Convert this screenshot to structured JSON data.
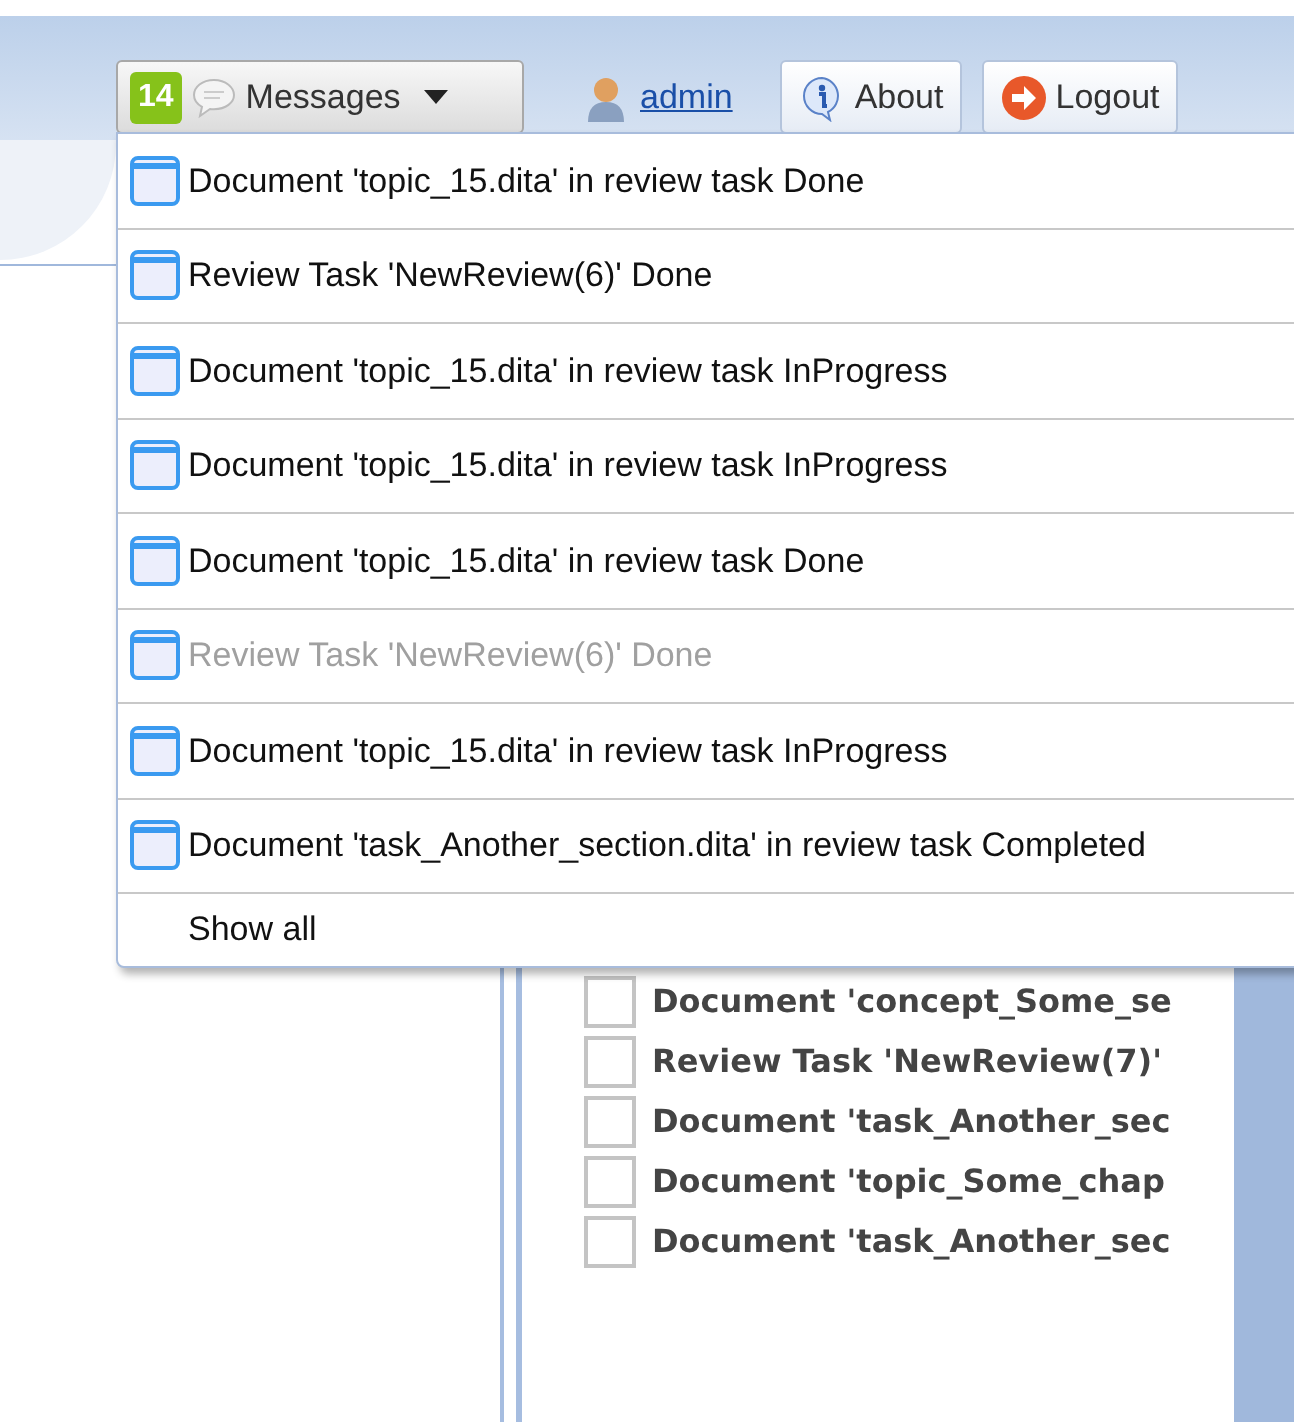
{
  "toolbar": {
    "messages_count": "14",
    "messages_label": "Messages",
    "user": "admin",
    "about": "About",
    "logout": "Logout"
  },
  "messages": [
    {
      "text": "Document 'topic_15.dita' in review task Done",
      "read": false
    },
    {
      "text": "Review Task 'NewReview(6)' Done",
      "read": false
    },
    {
      "text": "Document 'topic_15.dita' in review task InProgress",
      "read": false
    },
    {
      "text": "Document 'topic_15.dita' in review task InProgress",
      "read": false
    },
    {
      "text": "Document 'topic_15.dita' in review task Done",
      "read": false
    },
    {
      "text": "Review Task 'NewReview(6)' Done",
      "read": true
    },
    {
      "text": "Document 'topic_15.dita' in review task InProgress",
      "read": false
    },
    {
      "text": "Document 'task_Another_section.dita' in review task Completed",
      "read": false
    }
  ],
  "show_all": "Show all",
  "tasks": [
    {
      "text": "Document 'concept_Some_se",
      "checked": false
    },
    {
      "text": "Review Task 'NewReview(7)'",
      "checked": false
    },
    {
      "text": "Document 'task_Another_sec",
      "checked": false
    },
    {
      "text": "Document 'topic_Some_chap",
      "checked": false
    },
    {
      "text": "Document 'task_Another_sec",
      "checked": false
    }
  ]
}
